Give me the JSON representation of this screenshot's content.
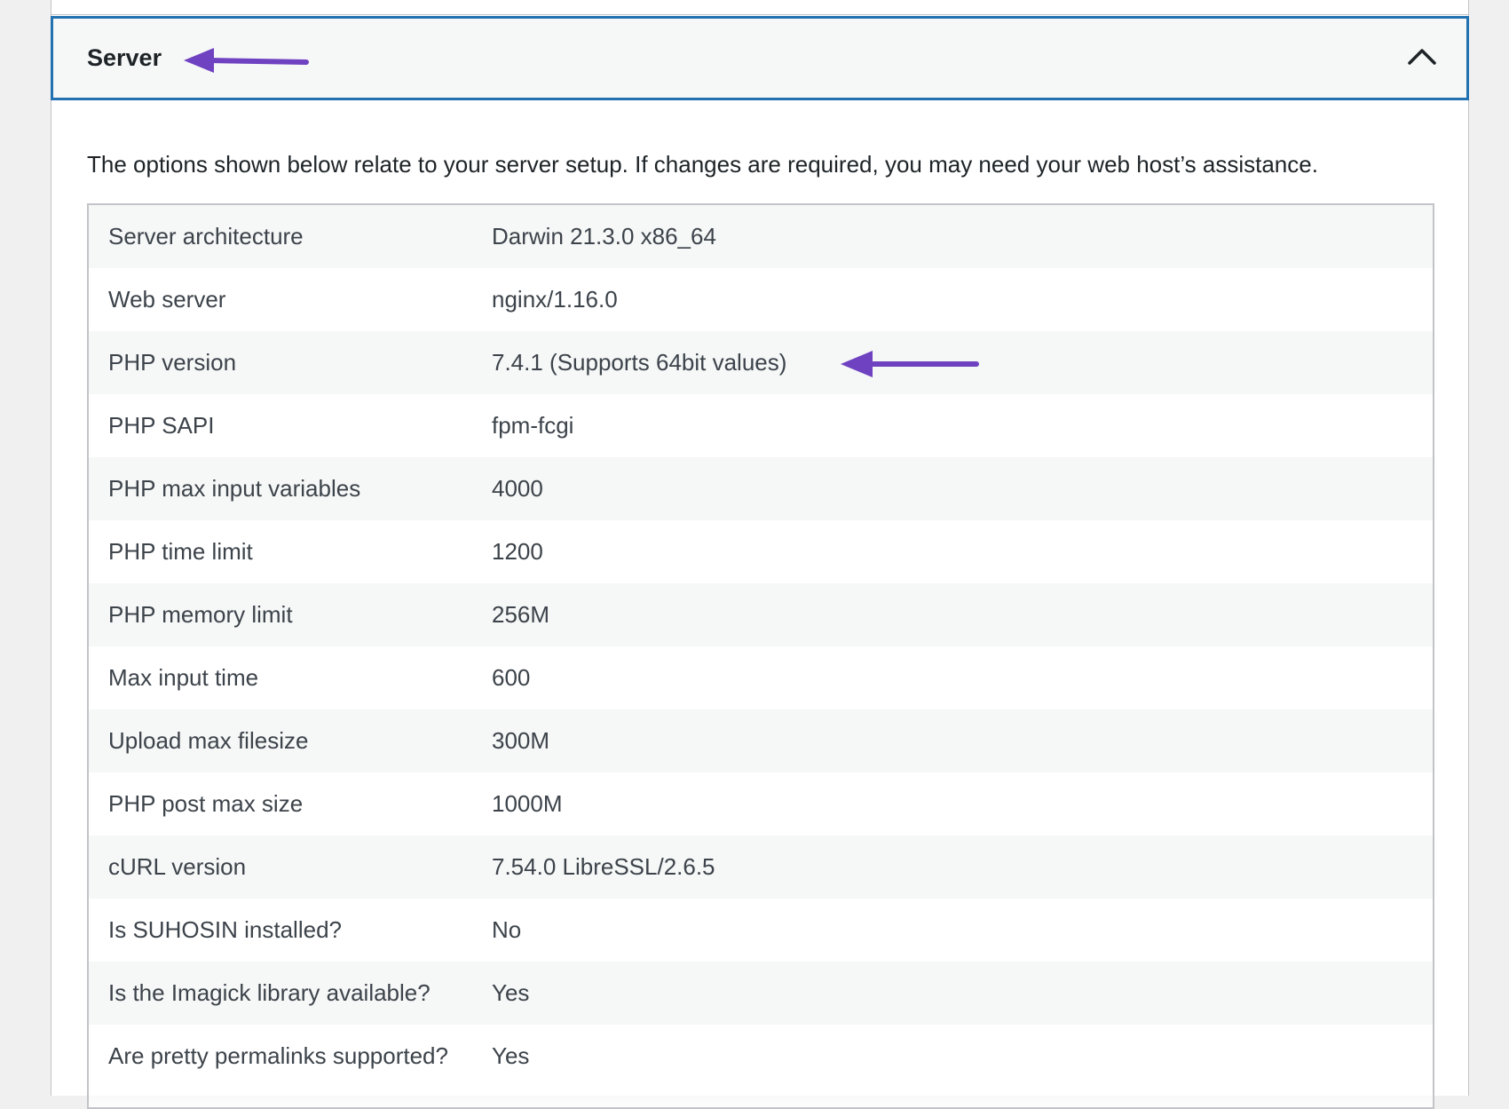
{
  "section": {
    "title": "Server",
    "expanded": true,
    "toggle_icon": "chevron-up-icon",
    "intro": "The options shown below relate to your server setup. If changes are required, you may need your web host’s assistance."
  },
  "rows": [
    {
      "label": "Server architecture",
      "value": "Darwin 21.3.0 x86_64"
    },
    {
      "label": "Web server",
      "value": "nginx/1.16.0"
    },
    {
      "label": "PHP version",
      "value": "7.4.1 (Supports 64bit values)"
    },
    {
      "label": "PHP SAPI",
      "value": "fpm-fcgi"
    },
    {
      "label": "PHP max input variables",
      "value": "4000"
    },
    {
      "label": "PHP time limit",
      "value": "1200"
    },
    {
      "label": "PHP memory limit",
      "value": "256M"
    },
    {
      "label": "Max input time",
      "value": "600"
    },
    {
      "label": "Upload max filesize",
      "value": "300M"
    },
    {
      "label": "PHP post max size",
      "value": "1000M"
    },
    {
      "label": "cURL version",
      "value": "7.54.0 LibreSSL/2.6.5"
    },
    {
      "label": "Is SUHOSIN installed?",
      "value": "No"
    },
    {
      "label": "Is the Imagick library available?",
      "value": "Yes"
    },
    {
      "label": "Are pretty permalinks supported?",
      "value": "Yes"
    }
  ],
  "colors": {
    "header_border": "#2271b1",
    "annotation_arrow": "#6f42c1",
    "row_alt": "#f6f7f7",
    "page_background": "#f0f0f1"
  }
}
